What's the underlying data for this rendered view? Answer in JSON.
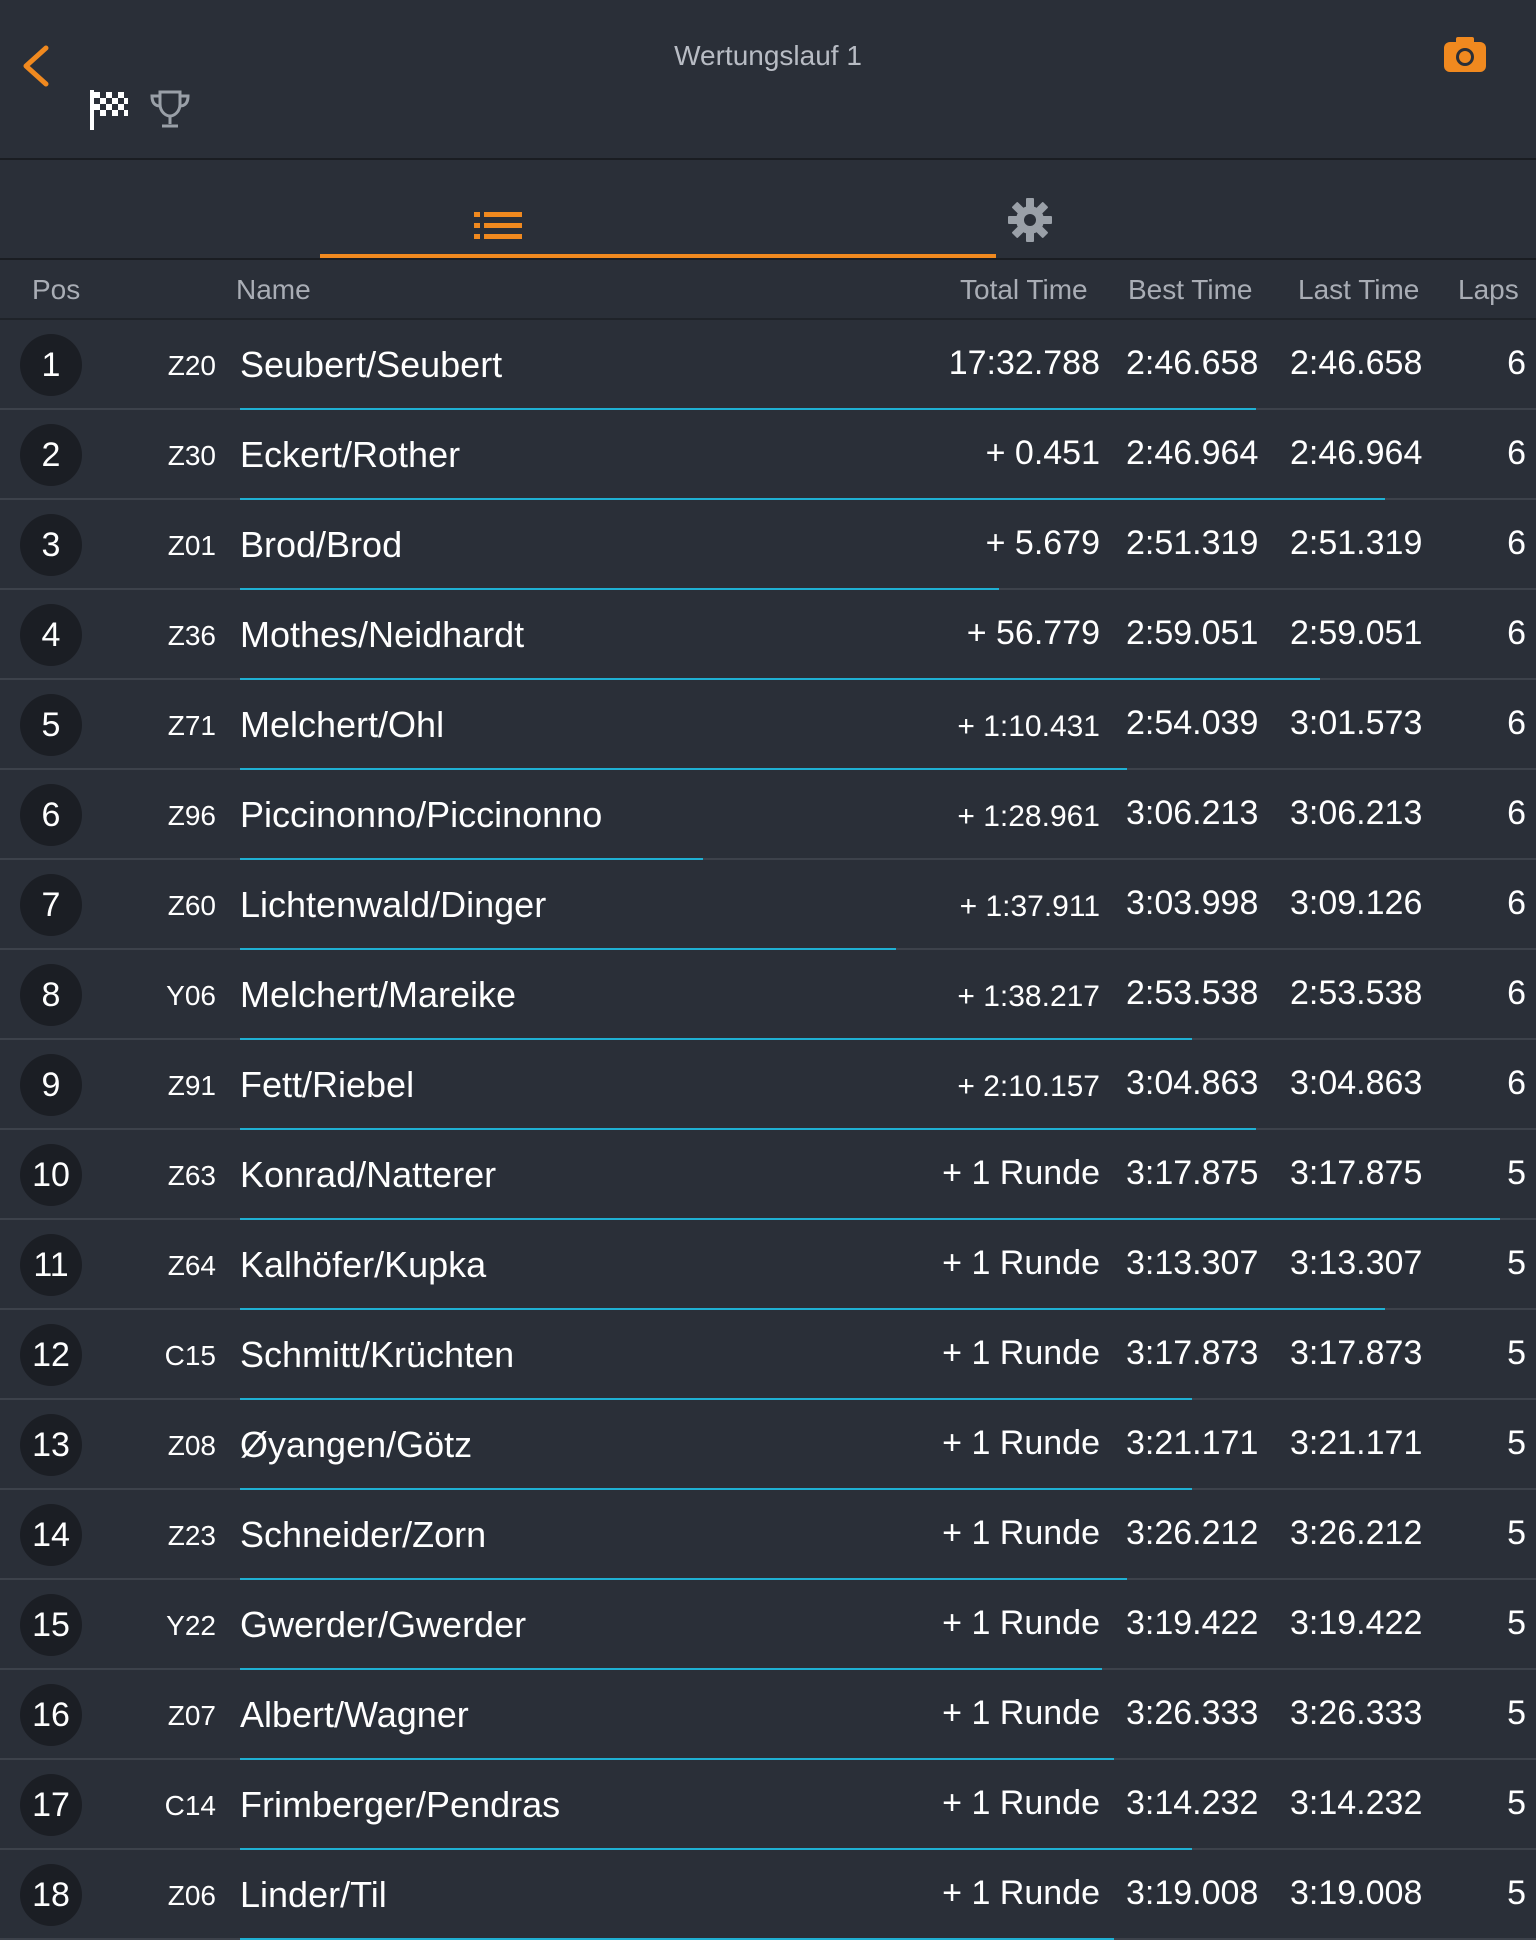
{
  "header": {
    "title": "Wertungslauf 1"
  },
  "tabs": [
    {
      "icon": "list-icon",
      "active": true
    },
    {
      "icon": "gear-icon",
      "active": false
    }
  ],
  "columns": {
    "pos": "Pos",
    "name": "Name",
    "total": "Total Time",
    "best": "Best Time",
    "last": "Last Time",
    "laps": "Laps"
  },
  "colors": {
    "accent": "#f0891f",
    "progress": "#1fb0d3",
    "background": "#2a2f38"
  },
  "rows": [
    {
      "pos": "1",
      "code": "Z20",
      "name": "Seubert/Seubert",
      "total": "17:32.788",
      "best": "2:46.658",
      "last": "2:46.658",
      "laps": "6",
      "progress": 0.79
    },
    {
      "pos": "2",
      "code": "Z30",
      "name": "Eckert/Rother",
      "total": "+ 0.451",
      "best": "2:46.964",
      "last": "2:46.964",
      "laps": "6",
      "progress": 0.89
    },
    {
      "pos": "3",
      "code": "Z01",
      "name": "Brod/Brod",
      "total": "+ 5.679",
      "best": "2:51.319",
      "last": "2:51.319",
      "laps": "6",
      "progress": 0.59
    },
    {
      "pos": "4",
      "code": "Z36",
      "name": "Mothes/Neidhardt",
      "total": "+ 56.779",
      "best": "2:59.051",
      "last": "2:59.051",
      "laps": "6",
      "progress": 0.84
    },
    {
      "pos": "5",
      "code": "Z71",
      "name": "Melchert/Ohl",
      "total": "+ 1:10.431",
      "best": "2:54.039",
      "last": "3:01.573",
      "laps": "6",
      "progress": 0.69
    },
    {
      "pos": "6",
      "code": "Z96",
      "name": "Piccinonno/Piccinonno",
      "total": "+ 1:28.961",
      "best": "3:06.213",
      "last": "3:06.213",
      "laps": "6",
      "progress": 0.36
    },
    {
      "pos": "7",
      "code": "Z60",
      "name": "Lichtenwald/Dinger",
      "total": "+ 1:37.911",
      "best": "3:03.998",
      "last": "3:09.126",
      "laps": "6",
      "progress": 0.51
    },
    {
      "pos": "8",
      "code": "Y06",
      "name": "Melchert/Mareike",
      "total": "+ 1:38.217",
      "best": "2:53.538",
      "last": "2:53.538",
      "laps": "6",
      "progress": 0.74
    },
    {
      "pos": "9",
      "code": "Z91",
      "name": "Fett/Riebel",
      "total": "+ 2:10.157",
      "best": "3:04.863",
      "last": "3:04.863",
      "laps": "6",
      "progress": 0.79
    },
    {
      "pos": "10",
      "code": "Z63",
      "name": "Konrad/Natterer",
      "total": "+ 1 Runde",
      "best": "3:17.875",
      "last": "3:17.875",
      "laps": "5",
      "progress": 0.98
    },
    {
      "pos": "11",
      "code": "Z64",
      "name": "Kalhöfer/Kupka",
      "total": "+ 1 Runde",
      "best": "3:13.307",
      "last": "3:13.307",
      "laps": "5",
      "progress": 0.89
    },
    {
      "pos": "12",
      "code": "C15",
      "name": "Schmitt/Krüchten",
      "total": "+ 1 Runde",
      "best": "3:17.873",
      "last": "3:17.873",
      "laps": "5",
      "progress": 0.74
    },
    {
      "pos": "13",
      "code": "Z08",
      "name": "Øyangen/Götz",
      "total": "+ 1 Runde",
      "best": "3:21.171",
      "last": "3:21.171",
      "laps": "5",
      "progress": 0.74
    },
    {
      "pos": "14",
      "code": "Z23",
      "name": "Schneider/Zorn",
      "total": "+ 1 Runde",
      "best": "3:26.212",
      "last": "3:26.212",
      "laps": "5",
      "progress": 0.69
    },
    {
      "pos": "15",
      "code": "Y22",
      "name": "Gwerder/Gwerder",
      "total": "+ 1 Runde",
      "best": "3:19.422",
      "last": "3:19.422",
      "laps": "5",
      "progress": 0.67
    },
    {
      "pos": "16",
      "code": "Z07",
      "name": "Albert/Wagner",
      "total": "+ 1 Runde",
      "best": "3:26.333",
      "last": "3:26.333",
      "laps": "5",
      "progress": 0.68
    },
    {
      "pos": "17",
      "code": "C14",
      "name": "Frimberger/Pendras",
      "total": "+ 1 Runde",
      "best": "3:14.232",
      "last": "3:14.232",
      "laps": "5",
      "progress": 0.74
    },
    {
      "pos": "18",
      "code": "Z06",
      "name": "Linder/Til",
      "total": "+ 1 Runde",
      "best": "3:19.008",
      "last": "3:19.008",
      "laps": "5",
      "progress": 0.68
    }
  ]
}
